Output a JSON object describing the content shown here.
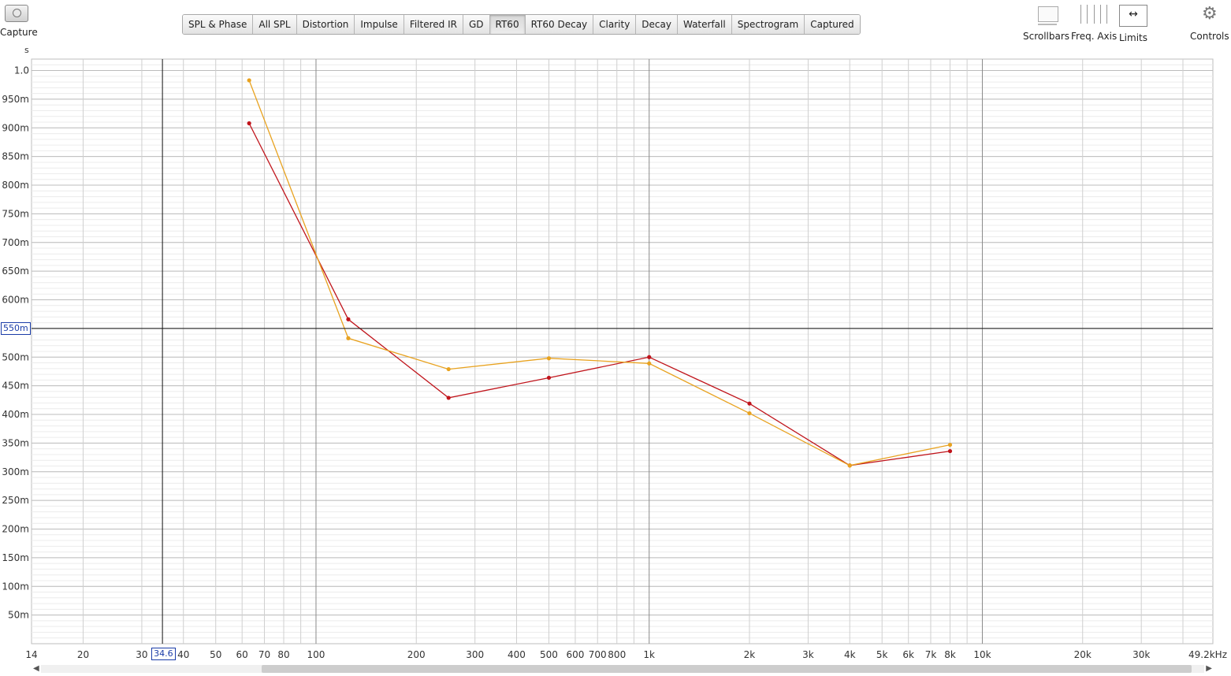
{
  "toolbar": {
    "capture_label": "Capture",
    "tabs": [
      {
        "label": "SPL & Phase",
        "active": false
      },
      {
        "label": "All SPL",
        "active": false
      },
      {
        "label": "Distortion",
        "active": false
      },
      {
        "label": "Impulse",
        "active": false
      },
      {
        "label": "Filtered IR",
        "active": false
      },
      {
        "label": "GD",
        "active": false
      },
      {
        "label": "RT60",
        "active": true
      },
      {
        "label": "RT60 Decay",
        "active": false
      },
      {
        "label": "Clarity",
        "active": false
      },
      {
        "label": "Decay",
        "active": false
      },
      {
        "label": "Waterfall",
        "active": false
      },
      {
        "label": "Spectrogram",
        "active": false
      },
      {
        "label": "Captured",
        "active": false
      }
    ],
    "right_tools": [
      {
        "label": "Scrollbars",
        "icon": "scrollbars-icon"
      },
      {
        "label": "Freq. Axis",
        "icon": "freq-axis-icon"
      },
      {
        "label": "Limits",
        "icon": "limits-icon"
      },
      {
        "label": "Controls",
        "icon": "gear-icon"
      }
    ]
  },
  "cursor": {
    "x_value": "34.6",
    "y_value": "550m",
    "x_hz": 34.6,
    "y_s": 0.55
  },
  "chart_data": {
    "type": "line",
    "title": "",
    "xlabel": "",
    "ylabel": "s",
    "x_scale": "log",
    "xlim": [
      14,
      49200
    ],
    "ylim": [
      0,
      1.02
    ],
    "grid": true,
    "x_ticks": [
      {
        "v": 14,
        "label": "14"
      },
      {
        "v": 20,
        "label": "20"
      },
      {
        "v": 30,
        "label": "30"
      },
      {
        "v": 40,
        "label": "40"
      },
      {
        "v": 50,
        "label": "50"
      },
      {
        "v": 60,
        "label": "60"
      },
      {
        "v": 70,
        "label": "70"
      },
      {
        "v": 80,
        "label": "80"
      },
      {
        "v": 100,
        "label": "100"
      },
      {
        "v": 200,
        "label": "200"
      },
      {
        "v": 300,
        "label": "300"
      },
      {
        "v": 400,
        "label": "400"
      },
      {
        "v": 500,
        "label": "500"
      },
      {
        "v": 600,
        "label": "600"
      },
      {
        "v": 700,
        "label": "700"
      },
      {
        "v": 800,
        "label": "800"
      },
      {
        "v": 1000,
        "label": "1k"
      },
      {
        "v": 2000,
        "label": "2k"
      },
      {
        "v": 3000,
        "label": "3k"
      },
      {
        "v": 4000,
        "label": "4k"
      },
      {
        "v": 5000,
        "label": "5k"
      },
      {
        "v": 6000,
        "label": "6k"
      },
      {
        "v": 7000,
        "label": "7k"
      },
      {
        "v": 8000,
        "label": "8k"
      },
      {
        "v": 10000,
        "label": "10k"
      },
      {
        "v": 20000,
        "label": "20k"
      },
      {
        "v": 30000,
        "label": "30k"
      },
      {
        "v": 49200,
        "label": "49.2kHz"
      }
    ],
    "y_ticks": [
      {
        "v": 0.05,
        "label": "50m"
      },
      {
        "v": 0.1,
        "label": "100m"
      },
      {
        "v": 0.15,
        "label": "150m"
      },
      {
        "v": 0.2,
        "label": "200m"
      },
      {
        "v": 0.25,
        "label": "250m"
      },
      {
        "v": 0.3,
        "label": "300m"
      },
      {
        "v": 0.35,
        "label": "350m"
      },
      {
        "v": 0.4,
        "label": "400m"
      },
      {
        "v": 0.45,
        "label": "450m"
      },
      {
        "v": 0.5,
        "label": "500m"
      },
      {
        "v": 0.6,
        "label": "600m"
      },
      {
        "v": 0.65,
        "label": "650m"
      },
      {
        "v": 0.7,
        "label": "700m"
      },
      {
        "v": 0.75,
        "label": "750m"
      },
      {
        "v": 0.8,
        "label": "800m"
      },
      {
        "v": 0.85,
        "label": "850m"
      },
      {
        "v": 0.9,
        "label": "900m"
      },
      {
        "v": 0.95,
        "label": "950m"
      },
      {
        "v": 1.0,
        "label": "1.0"
      }
    ],
    "x": [
      63,
      125,
      250,
      500,
      1000,
      2000,
      4000,
      8000
    ],
    "series": [
      {
        "color": "#c0141b",
        "values": [
          0.908,
          0.566,
          0.429,
          0.464,
          0.5,
          0.419,
          0.311,
          0.336
        ]
      },
      {
        "color": "#e8a21f",
        "values": [
          0.983,
          0.533,
          0.479,
          0.498,
          0.489,
          0.402,
          0.311,
          0.347
        ]
      }
    ]
  },
  "scrollbar": {
    "left_arrow": "◀",
    "right_arrow": "▶"
  }
}
